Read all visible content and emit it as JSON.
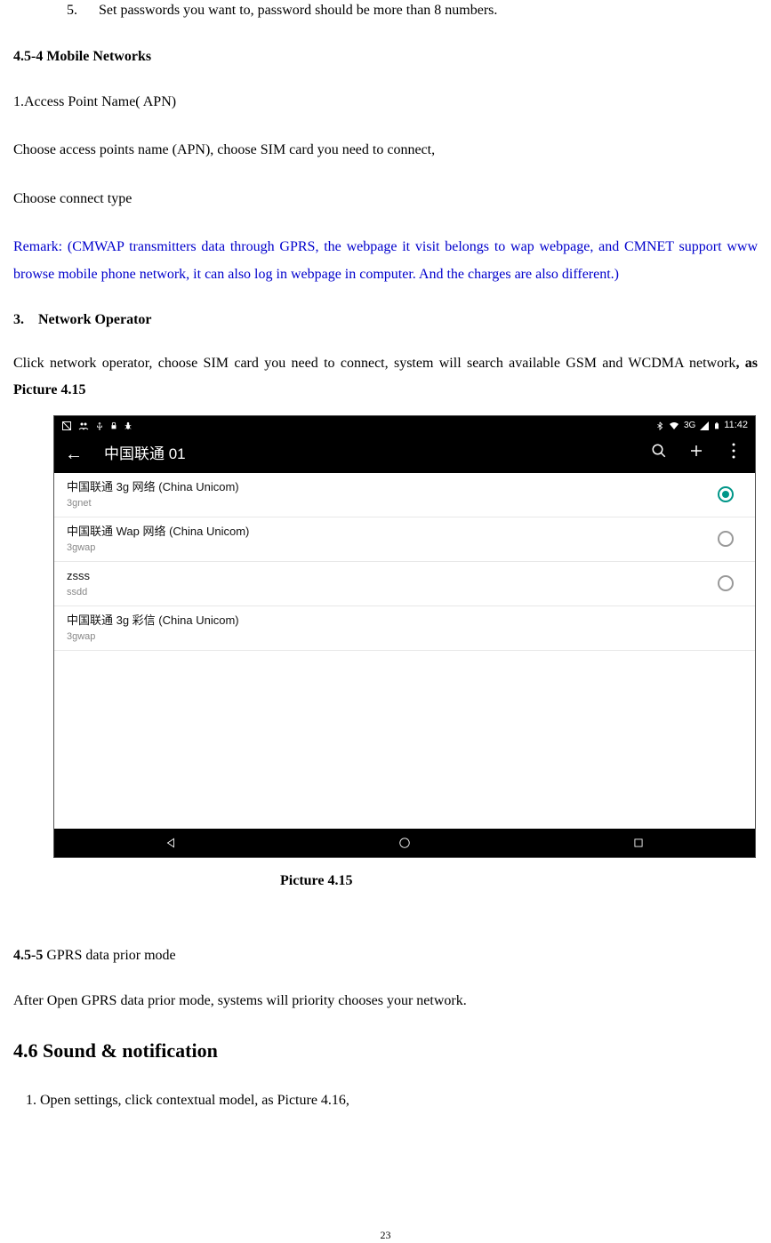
{
  "item5": {
    "num": "5.",
    "text": "Set passwords you want to, password should be more than 8 numbers."
  },
  "heading454": "4.5-4 Mobile Networks",
  "apnLine": "1.Access Point Name( APN)",
  "chooseApn": "Choose access points name (APN), choose SIM card you need to connect,",
  "chooseConnect": "Choose connect type",
  "remark": "Remark: (CMWAP transmitters data through GPRS, the webpage it visit belongs to wap webpage, and CMNET support www browse mobile phone network, it can also log in webpage in computer. And the charges are also different.)",
  "item3": {
    "num": "3.",
    "text": "Network Operator"
  },
  "netOpText1": "Click network operator, choose SIM card you need to connect, system will search available GSM and WCDMA network",
  "netOpText2": ", as Picture 4.15",
  "statusbar": {
    "netlabel": "3G",
    "time": "11:42"
  },
  "appbar": {
    "title": "中国联通 01"
  },
  "apns": [
    {
      "title": "中国联通 3g 网络 (China Unicom)",
      "sub": "3gnet",
      "selected": true,
      "showRadio": true
    },
    {
      "title": "中国联通 Wap 网络 (China Unicom)",
      "sub": "3gwap",
      "selected": false,
      "showRadio": true
    },
    {
      "title": "zsss",
      "sub": "ssdd",
      "selected": false,
      "showRadio": true
    },
    {
      "title": "中国联通 3g 彩信 (China Unicom)",
      "sub": "3gwap",
      "selected": false,
      "showRadio": false
    }
  ],
  "caption": "Picture 4.15",
  "heading455_num": "4.5-5",
  "heading455_text": " GPRS data prior mode",
  "gprsPara": "After Open GPRS data prior mode, systems will priority chooses your network.",
  "heading46": "4.6 Sound & notification",
  "soundPara": "1. Open settings, click contextual model, as Picture 4.16,",
  "pageNum": "23"
}
